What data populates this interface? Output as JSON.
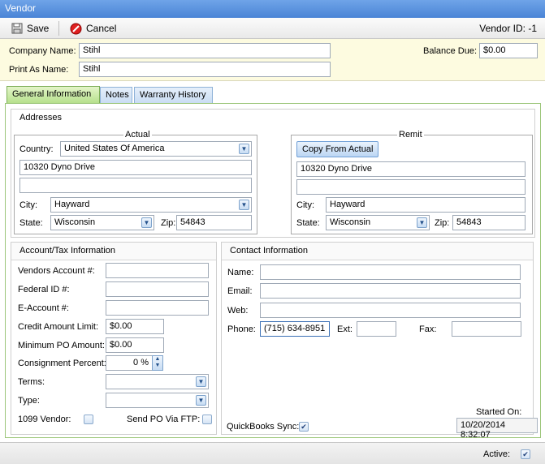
{
  "window": {
    "title": "Vendor"
  },
  "toolbar": {
    "save_label": "Save",
    "cancel_label": "Cancel",
    "vendor_id": "Vendor ID: -1"
  },
  "header": {
    "company_name_label": "Company Name:",
    "company_name": "Stihl",
    "print_as_label": "Print As Name:",
    "print_as": "Stihl",
    "balance_due_label": "Balance Due:",
    "balance_due": "$0.00"
  },
  "tabs": [
    {
      "label": "General Information"
    },
    {
      "label": "Notes"
    },
    {
      "label": "Warranty History"
    }
  ],
  "addresses": {
    "title": "Addresses",
    "actual": {
      "title": "Actual",
      "country_label": "Country:",
      "country": "United States Of America",
      "line1": "10320 Dyno Drive",
      "line2": "",
      "city_label": "City:",
      "city": "Hayward",
      "state_label": "State:",
      "state": "Wisconsin",
      "zip_label": "Zip:",
      "zip": "54843"
    },
    "remit": {
      "title": "Remit",
      "copy_button": "Copy From Actual",
      "line1": "10320 Dyno Drive",
      "line2": "",
      "city_label": "City:",
      "city": "Hayward",
      "state_label": "State:",
      "state": "Wisconsin",
      "zip_label": "Zip:",
      "zip": "54843"
    }
  },
  "account": {
    "title": "Account/Tax Information",
    "vendors_account_label": "Vendors Account #:",
    "vendors_account": "",
    "federal_id_label": "Federal ID #:",
    "federal_id": "",
    "e_account_label": "E-Account #:",
    "e_account": "",
    "credit_limit_label": "Credit Amount Limit:",
    "credit_limit": "$0.00",
    "min_po_label": "Minimum PO Amount:",
    "min_po": "$0.00",
    "consignment_label": "Consignment Percent:",
    "consignment": "0 %",
    "terms_label": "Terms:",
    "terms": "",
    "type_label": "Type:",
    "type": "",
    "vendor1099_label": "1099 Vendor:",
    "vendor1099_checked": false,
    "send_po_label": "Send PO Via FTP:",
    "send_po_checked": false
  },
  "contact": {
    "title": "Contact Information",
    "name_label": "Name:",
    "name": "",
    "email_label": "Email:",
    "email": "",
    "web_label": "Web:",
    "web": "",
    "phone_label": "Phone:",
    "phone": "(715) 634-8951",
    "ext_label": "Ext:",
    "ext": "",
    "fax_label": "Fax:",
    "fax": "",
    "quickbooks_label": "QuickBooks Sync:",
    "quickbooks_checked": true,
    "started_on_label": "Started On:",
    "started_on": "10/20/2014 8:32:07"
  },
  "footer": {
    "active_label": "Active:",
    "active_checked": true
  },
  "colors": {
    "title_bar": "#4a84d6",
    "header_bg": "#fdfbe0",
    "active_tab": "#b6e08c"
  }
}
